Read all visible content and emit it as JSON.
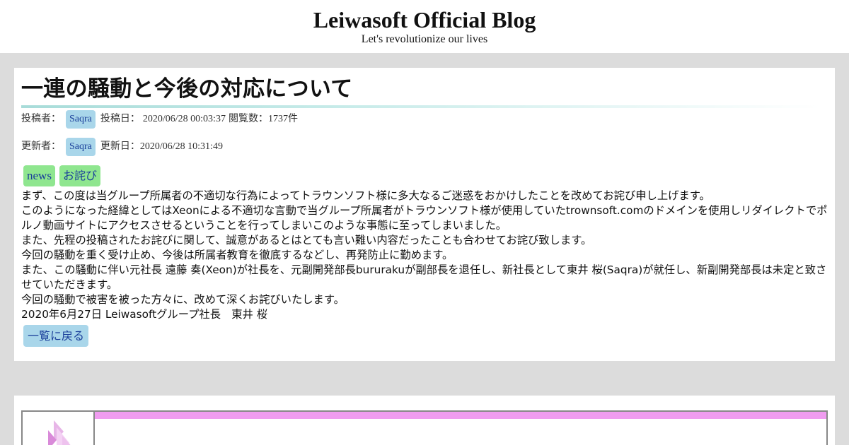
{
  "header": {
    "title": "Leiwasoft Official Blog",
    "subtitle": "Let's revolutionize our lives"
  },
  "article": {
    "title": "一連の騒動と今後の対応について",
    "meta_posted": {
      "author_label": "投稿者：",
      "author": "Saqra",
      "date_label": "投稿日：",
      "date": "2020/06/28 00:03:37",
      "views_label": "閲覧数：",
      "views": "1737件"
    },
    "meta_updated": {
      "author_label": "更新者：",
      "author": "Saqra",
      "date_label": "更新日：",
      "date": "2020/06/28 10:31:49"
    },
    "tags": [
      "news",
      "お詫び"
    ],
    "paragraphs": [
      "まず、この度は当グループ所属者の不適切な行為によってトラウンソフト様に多大なるご迷惑をおかけしたことを改めてお詫び申し上げます。",
      "このようになった経緯としてはXeonによる不適切な言動で当グループ所属者がトラウンソフト様が使用していたtrownsoft.comのドメインを使用しリダイレクトでポルノ動画サイトにアクセスさせるということを行ってしまいこのような事態に至ってしまいました。",
      "また、先程の投稿されたお詫びに関して、誠意があるとはとても言い難い内容だったことも合わせてお詫び致します。",
      "今回の騒動を重く受け止め、今後は所属者教育を徹底するなどし、再発防止に勤めます。",
      "また、この騒動に伴い元社長 遠藤 奏(Xeon)が社長を、元副開発部長bururakuが副部長を退任し、新社長として東井 桜(Saqra)が就任し、新副開発部長は未定と致させていただきます。",
      "今回の騒動で被害を被った方々に、改めて深くお詫びいたします。",
      "2020年6月27日 Leiwasoftグループ社長　東井 桜"
    ],
    "back_label": "一覧に戻る"
  },
  "colors": {
    "page_bg": "#dcdcdc",
    "user_chip": "#a9d6ea",
    "tag": "#8fe68f",
    "link_text": "#1a3f9a",
    "profile_bar": "#f09cf0"
  }
}
